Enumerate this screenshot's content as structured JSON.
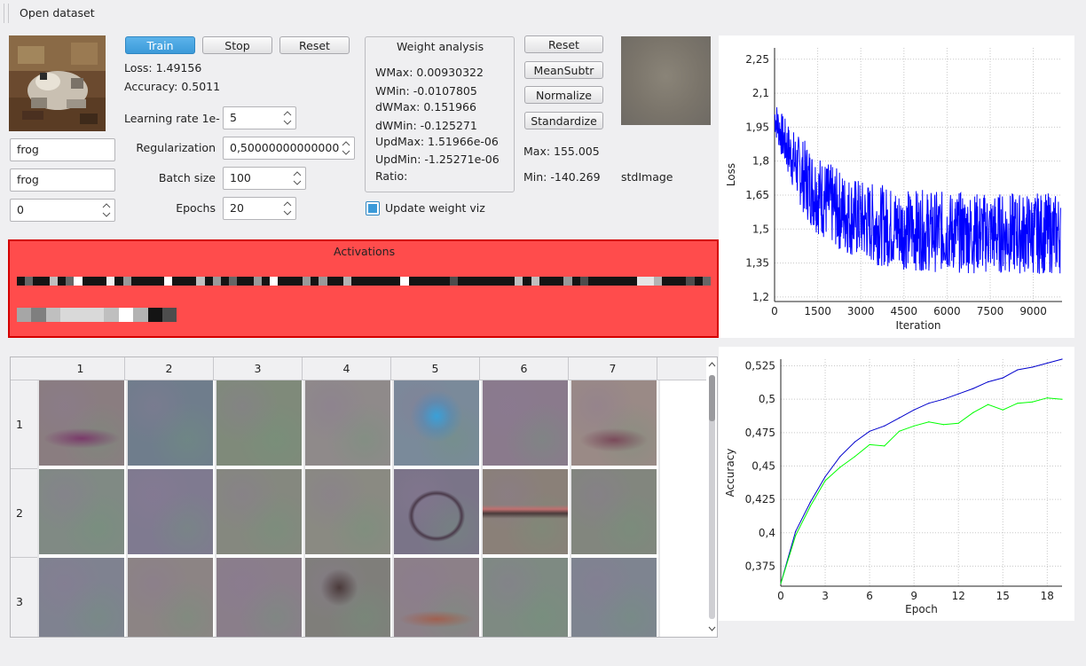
{
  "menubar": {
    "open_dataset": "Open dataset"
  },
  "sample": {
    "label_true": "frog",
    "label_pred": "frog",
    "index": "0"
  },
  "training": {
    "train": "Train",
    "stop": "Stop",
    "reset": "Reset",
    "loss_text": "Loss: 1.49156",
    "accuracy_text": "Accuracy: 0.5011",
    "lr_label": "Learning rate 1e-",
    "lr_value": "5",
    "reg_label": "Regularization",
    "reg_value": "0,500000000000000",
    "batch_label": "Batch size",
    "batch_value": "100",
    "epochs_label": "Epochs",
    "epochs_value": "20"
  },
  "weights": {
    "title": "Weight analysis",
    "wmax": "WMax: 0.00930322",
    "wmin": "WMin: -0.0107805",
    "dwmax": "dWMax: 0.151966",
    "dwmin": "dWMin: -0.125271",
    "updmax": "UpdMax: 1.51966e-06",
    "updmin": "UpdMin: -1.25271e-06",
    "ratio": "Ratio:",
    "update_viz": "Update weight viz",
    "update_viz_checked": true
  },
  "preprocess": {
    "reset": "Reset",
    "meansubtr": "MeanSubtr",
    "normalize": "Normalize",
    "standardize": "Standardize",
    "max": "Max: 155.005",
    "min": "Min: -140.269",
    "image_label": "stdImage"
  },
  "activations": {
    "title": "Activations",
    "row1": [
      8,
      40,
      8,
      8,
      75,
      8,
      40,
      100,
      8,
      8,
      8,
      95,
      8,
      60,
      8,
      8,
      8,
      8,
      100,
      8,
      8,
      8,
      75,
      8,
      60,
      8,
      40,
      8,
      8,
      60,
      8,
      100,
      8,
      8,
      8,
      60,
      8,
      60,
      8,
      8,
      70,
      8,
      8,
      8,
      8,
      8,
      8,
      100,
      8,
      8,
      8,
      8,
      8,
      30,
      8,
      8,
      8,
      8,
      8,
      8,
      8,
      75,
      8,
      75,
      8,
      8,
      8,
      60,
      8,
      30,
      8,
      8,
      8,
      8,
      8,
      8,
      90,
      90,
      70,
      8,
      8,
      8,
      30,
      8,
      40
    ],
    "row2": [
      65,
      50,
      75,
      85,
      85,
      85,
      75,
      100,
      70,
      8,
      30
    ]
  },
  "weight_grid": {
    "columns": [
      "1",
      "2",
      "3",
      "4",
      "5",
      "6",
      "7"
    ],
    "rows": [
      "1",
      "2",
      "3"
    ]
  },
  "loss_chart": {
    "ylabel": "Loss",
    "xlabel": "Iteration",
    "x_ticks": [
      "0",
      "1500",
      "3000",
      "4500",
      "6000",
      "7500",
      "9000"
    ],
    "y_ticks": [
      "1,2",
      "1,35",
      "1,5",
      "1,65",
      "1,8",
      "1,95",
      "2,1",
      "2,25"
    ],
    "color": "#0000ff"
  },
  "chart_data": {
    "type": "line",
    "xlabel": "Epoch",
    "ylabel": "Accuracy",
    "x": [
      0,
      1,
      2,
      3,
      4,
      5,
      6,
      7,
      8,
      9,
      10,
      11,
      12,
      13,
      14,
      15,
      16,
      17,
      18,
      19
    ],
    "ylim": [
      0.36,
      0.53
    ],
    "series": [
      {
        "color": "#0000cc",
        "values": [
          0.362,
          0.401,
          0.423,
          0.442,
          0.457,
          0.468,
          0.476,
          0.48,
          0.486,
          0.492,
          0.497,
          0.5,
          0.504,
          0.508,
          0.513,
          0.516,
          0.522,
          0.524,
          0.527,
          0.53
        ]
      },
      {
        "color": "#00ff00",
        "values": [
          0.362,
          0.398,
          0.42,
          0.439,
          0.449,
          0.457,
          0.466,
          0.465,
          0.476,
          0.48,
          0.483,
          0.481,
          0.482,
          0.49,
          0.496,
          0.492,
          0.497,
          0.498,
          0.501,
          0.5
        ]
      }
    ],
    "x_ticks": [
      "0",
      "3",
      "6",
      "9",
      "12",
      "15",
      "18"
    ],
    "y_ticks": [
      "0,375",
      "0,4",
      "0,425",
      "0,45",
      "0,475",
      "0,5",
      "0,525"
    ]
  }
}
